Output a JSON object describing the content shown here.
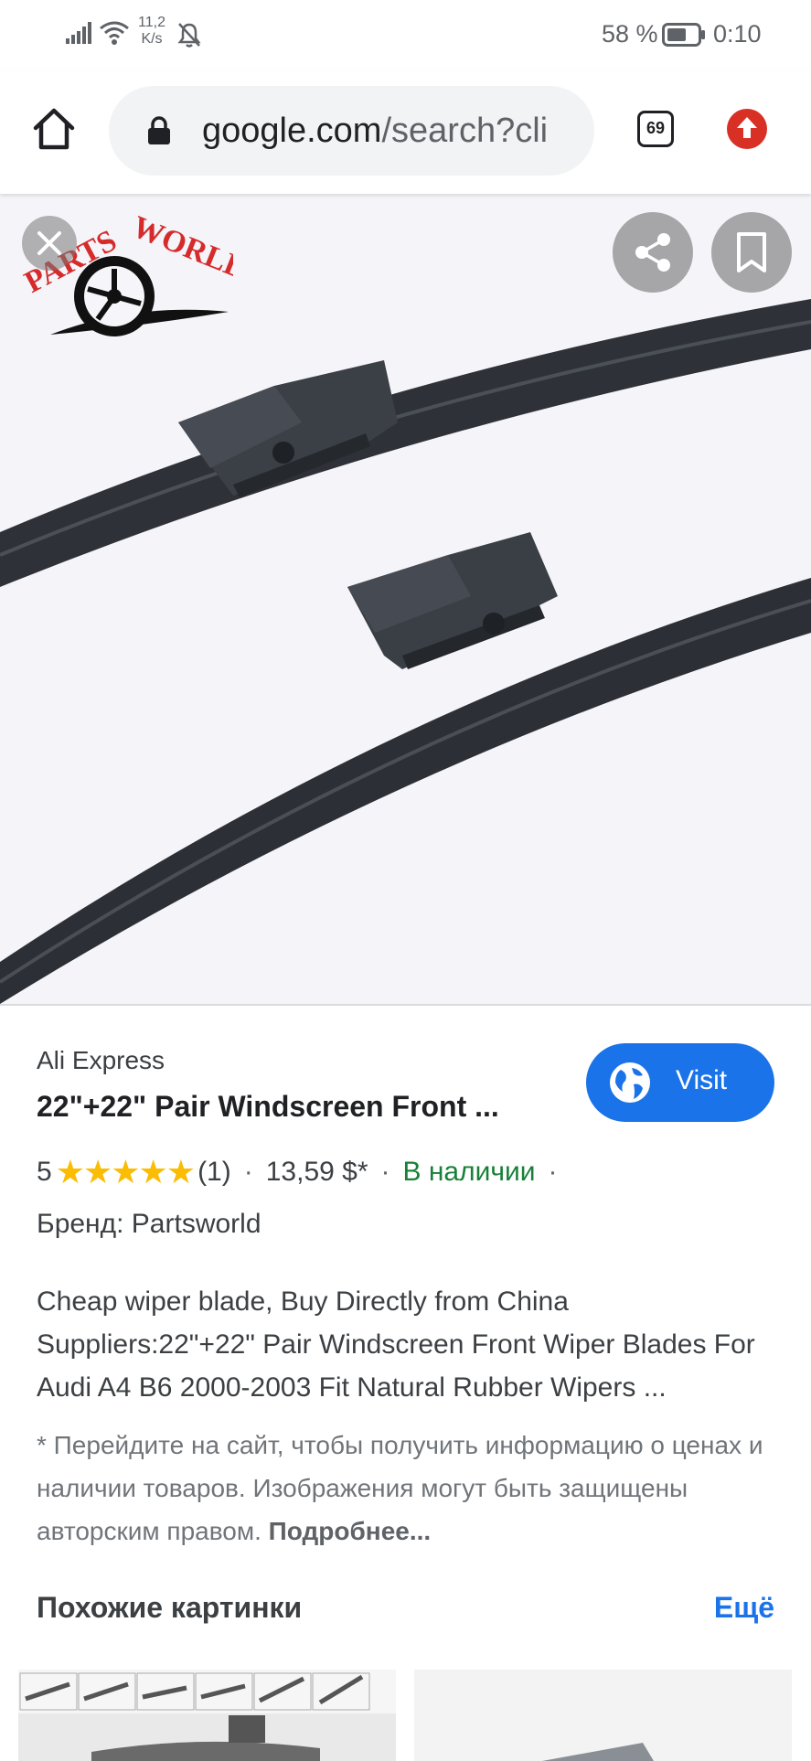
{
  "status_bar": {
    "net_speed_value": "11,2",
    "net_speed_unit": "K/s",
    "battery_percent": "58 %",
    "time": "0:10",
    "icons": [
      "signal-icon",
      "wifi-icon",
      "bell-muted-icon",
      "battery-icon"
    ]
  },
  "browser": {
    "url_domain": "google.com",
    "url_path": "/search?cli",
    "tab_count": "69",
    "icons": [
      "home-icon",
      "lock-icon",
      "tabs-icon",
      "update-icon"
    ]
  },
  "image_viewer": {
    "logo_text": "PARTS WORLD",
    "icons": [
      "close-icon",
      "share-icon",
      "bookmark-icon"
    ]
  },
  "product": {
    "source": "Ali Express",
    "title": "22\"+22\" Pair Windscreen Front ...",
    "visit_label": "Visit",
    "rating_value": "5",
    "stars": "★★★★★",
    "rating_count": "(1)",
    "price": "13,59 $*",
    "stock": "В наличии",
    "brand": "Бренд: Partsworld",
    "description": "Cheap wiper blade, Buy Directly from China Suppliers:22\"+22\" Pair Windscreen Front Wiper Blades For Audi A4 B6 2000-2003 Fit Natural Rubber Wipers ...",
    "note": "* Перейдите на сайт, чтобы получить информацию о ценах и наличии товаров. Изображения могут быть защищены авторским правом.",
    "note_more": "Подробнее..."
  },
  "similar": {
    "title": "Похожие картинки",
    "more": "Ещё"
  },
  "colors": {
    "accent": "#1a73e8",
    "stock_green": "#188038",
    "star": "#fbbc04",
    "update_red": "#d93025"
  }
}
